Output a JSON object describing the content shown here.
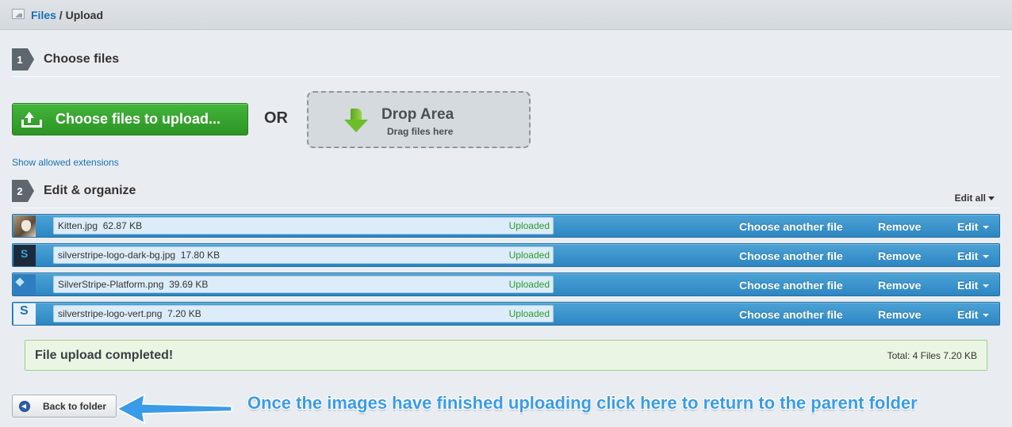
{
  "breadcrumb": {
    "parent": "Files",
    "separator": "/",
    "current": "Upload"
  },
  "step1": {
    "number": "1",
    "title": "Choose files"
  },
  "upload": {
    "button_label": "Choose files to upload...",
    "or_label": "OR",
    "drop_title": "Drop Area",
    "drop_sub": "Drag files here"
  },
  "extensions_link": "Show allowed extensions",
  "step2": {
    "number": "2",
    "title": "Edit & organize"
  },
  "edit_all": "Edit all",
  "files": [
    {
      "name": "Kitten.jpg",
      "size": "62.87 KB",
      "status": "Uploaded",
      "thumb": "kitten"
    },
    {
      "name": "silverstripe-logo-dark-bg.jpg",
      "size": "17.80 KB",
      "status": "Uploaded",
      "thumb": "dark"
    },
    {
      "name": "SilverStripe-Platform.png",
      "size": "39.69 KB",
      "status": "Uploaded",
      "thumb": "platform"
    },
    {
      "name": "silverstripe-logo-vert.png",
      "size": "7.20 KB",
      "status": "Uploaded",
      "thumb": "vert"
    }
  ],
  "row_actions": {
    "choose": "Choose another file",
    "remove": "Remove",
    "edit": "Edit"
  },
  "completion": {
    "message": "File upload completed!",
    "total": "Total: 4 Files 7.20 KB"
  },
  "back_button": "Back to folder",
  "annotation": "Once the images have finished uploading click here to return to the parent folder",
  "colors": {
    "accent": "#2d86c2",
    "success": "#2c9424",
    "annotation": "#3a9be8"
  }
}
